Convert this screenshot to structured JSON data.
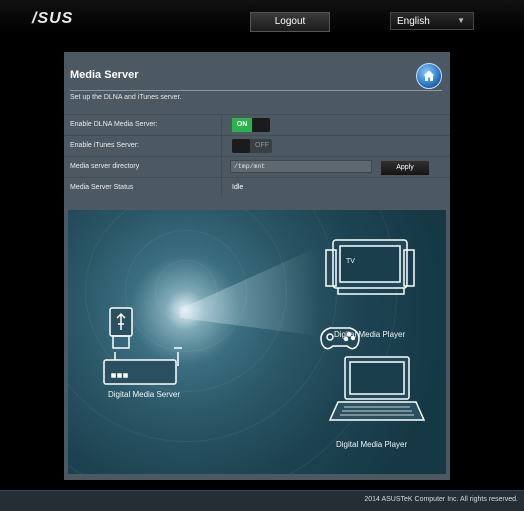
{
  "header": {
    "logo": "/SUS",
    "logout_label": "Logout",
    "language": "English"
  },
  "panel": {
    "title": "Media Server",
    "description": "Set up the DLNA and iTunes server.",
    "home_icon": "home-icon"
  },
  "settings": [
    {
      "label": "Enable DLNA Media Server:",
      "toggle_text": "ON"
    },
    {
      "label": "Enable iTunes Server:",
      "toggle_text": "OFF"
    },
    {
      "label": "Media server directory",
      "input_value": "/tmp/mnt",
      "button_label": "Apply"
    },
    {
      "label": "Media Server Status",
      "status": "Idle"
    }
  ],
  "illustration": {
    "server_label": "Digital  Media Server",
    "player_label_1": "Digital  Media Player",
    "player_label_2": "Digital  Media Player",
    "tv_text": "TV"
  },
  "footer": {
    "copyright": "2014 ASUSTeK Computer Inc. All rights reserved."
  },
  "colors": {
    "panel_bg": "#4d5962",
    "toggle_on": "#28b34b",
    "accent_blue": "#1f6fbf"
  }
}
